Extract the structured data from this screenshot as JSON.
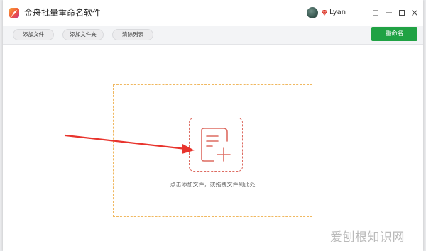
{
  "app": {
    "title": "金舟批量重命名软件"
  },
  "user": {
    "name": "Lyan"
  },
  "toolbar": {
    "add_file": "添加文件",
    "add_folder": "添加文件夹",
    "clear_list": "清除列表",
    "rename": "重命名"
  },
  "dropzone": {
    "hint": "点击添加文件，或拖拽文件到此处"
  },
  "watermark": "爱刨根知识网",
  "colors": {
    "accent_green": "#20a244",
    "dropzone_border": "#f0b860",
    "add_box_border": "#dd6b61",
    "arrow_red": "#e8342d"
  },
  "icons": {
    "app_logo": "feather-logo-icon",
    "vip": "vip-diamond-icon",
    "menu": "hamburger-menu-icon",
    "minimize": "minimize-icon",
    "maximize": "maximize-icon",
    "close": "close-icon",
    "add_file": "add-document-icon",
    "arrow": "red-arrow-icon"
  }
}
